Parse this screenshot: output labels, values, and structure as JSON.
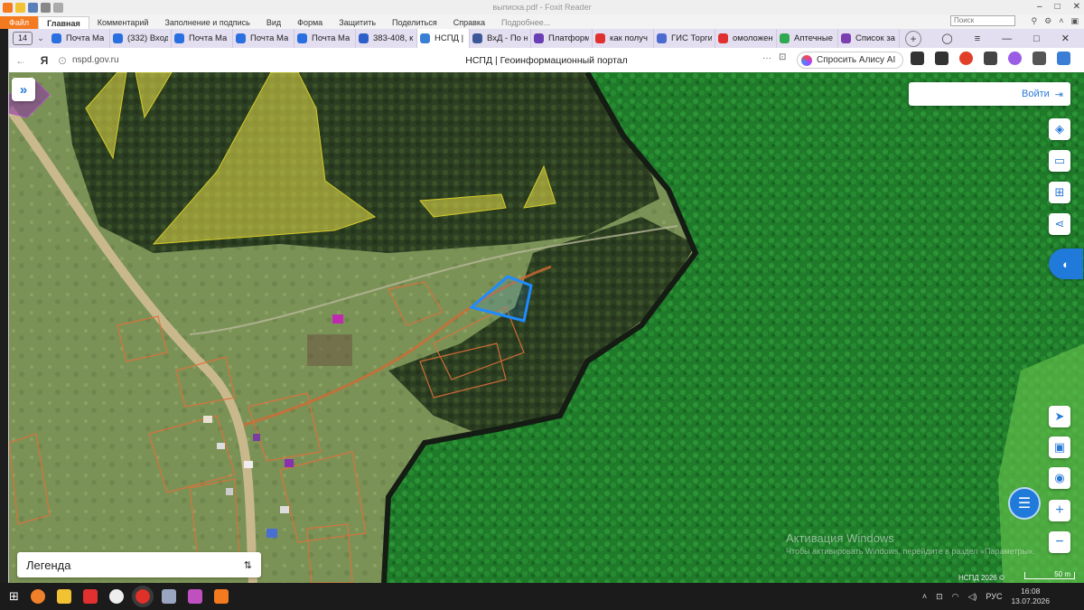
{
  "foxit": {
    "title": "выписка.pdf - Foxit Reader",
    "menu": [
      "Файл",
      "Главная",
      "Комментарий",
      "Заполнение и подпись",
      "Вид",
      "Форма",
      "Защитить",
      "Поделиться",
      "Справка",
      "Подробнее..."
    ],
    "search_placeholder": "Поиск"
  },
  "browser": {
    "tab_count": "14",
    "tabs": [
      {
        "label": "Почта Ма",
        "color": "#2a6fe0"
      },
      {
        "label": "(332) Вход",
        "color": "#2a6fe0"
      },
      {
        "label": "Почта Ма",
        "color": "#2a6fe0"
      },
      {
        "label": "Почта Ма",
        "color": "#2a6fe0"
      },
      {
        "label": "Почта Ма",
        "color": "#2a6fe0"
      },
      {
        "label": "383-408, к",
        "color": "#2e5fc8"
      },
      {
        "label": "НСПД |",
        "color": "#3a7fd5",
        "active": true
      },
      {
        "label": "ВхД - По н",
        "color": "#3b5998"
      },
      {
        "label": "Платформ",
        "color": "#6a3fb5"
      },
      {
        "label": "как получ",
        "color": "#e03030"
      },
      {
        "label": "ГИС Торги",
        "color": "#4a6ad0"
      },
      {
        "label": "омоложен",
        "color": "#e03030"
      },
      {
        "label": "Аптечные",
        "color": "#2fa84f"
      },
      {
        "label": "Список за",
        "color": "#7a3fb0"
      }
    ],
    "url": "nspd.gov.ru",
    "page_title": "НСПД | Геоинформационный портал",
    "alice_label": "Спросить Алису AI"
  },
  "map": {
    "login_label": "Войти",
    "legend_label": "Легенда",
    "copyright": "НСПД 2026 ©",
    "scale_label": "50 m",
    "watermark_line1": "Активация Windows",
    "watermark_line2": "Чтобы активировать Windows, перейдите в раздел «Параметры».",
    "colors": {
      "accent": "#2a7ad8",
      "selected_parcel": "#1e8cff",
      "parcel_outline": "#e0703a",
      "zone_fill": "#e8e04a"
    }
  },
  "taskbar": {
    "lang": "РУС",
    "time": "16:08",
    "date": "13.07.2026"
  }
}
